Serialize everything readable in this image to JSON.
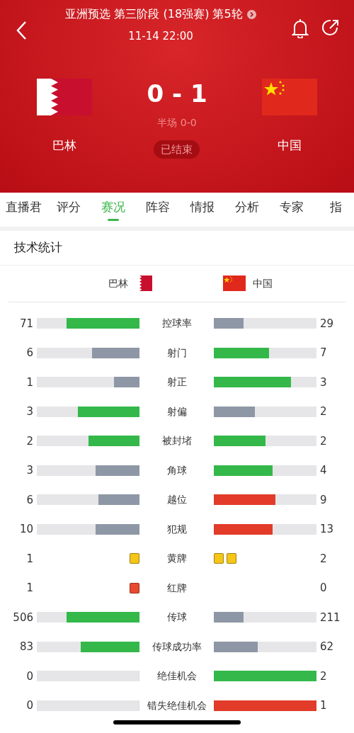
{
  "header": {
    "title": "亚洲预选 第三阶段 (18强赛) 第5轮",
    "time": "11-14 22:00",
    "home": {
      "name": "巴林",
      "kind": "bahrain"
    },
    "away": {
      "name": "中国",
      "kind": "china"
    },
    "score": "0 - 1",
    "half_time": "半场 0-0",
    "status": "已结束"
  },
  "tabs": [
    {
      "label": "直播君",
      "selected": false
    },
    {
      "label": "评分",
      "selected": false
    },
    {
      "label": "赛况",
      "selected": true
    },
    {
      "label": "阵容",
      "selected": false
    },
    {
      "label": "情报",
      "selected": false
    },
    {
      "label": "分析",
      "selected": false
    },
    {
      "label": "专家",
      "selected": false
    },
    {
      "label": "指",
      "selected": false
    }
  ],
  "stats": {
    "title": "技术统计",
    "home_team": "巴林",
    "away_team": "中国",
    "rows": [
      {
        "kind": "bar",
        "label": "控球率",
        "home": {
          "value": "71",
          "level": 0.71,
          "color": "#34b84a"
        },
        "away": {
          "value": "29",
          "level": 0.29,
          "color": "#8e97a5"
        }
      },
      {
        "kind": "bar",
        "label": "射门",
        "home": {
          "value": "6",
          "level": 0.46,
          "color": "#8e97a5"
        },
        "away": {
          "value": "7",
          "level": 0.54,
          "color": "#34b84a"
        }
      },
      {
        "kind": "bar",
        "label": "射正",
        "home": {
          "value": "1",
          "level": 0.25,
          "color": "#8e97a5"
        },
        "away": {
          "value": "3",
          "level": 0.75,
          "color": "#34b84a"
        }
      },
      {
        "kind": "bar",
        "label": "射偏",
        "home": {
          "value": "3",
          "level": 0.6,
          "color": "#34b84a"
        },
        "away": {
          "value": "2",
          "level": 0.4,
          "color": "#8e97a5"
        }
      },
      {
        "kind": "bar",
        "label": "被封堵",
        "home": {
          "value": "2",
          "level": 0.5,
          "color": "#34b84a"
        },
        "away": {
          "value": "2",
          "level": 0.5,
          "color": "#34b84a"
        }
      },
      {
        "kind": "bar",
        "label": "角球",
        "home": {
          "value": "3",
          "level": 0.43,
          "color": "#8e97a5"
        },
        "away": {
          "value": "4",
          "level": 0.57,
          "color": "#34b84a"
        }
      },
      {
        "kind": "bar",
        "label": "越位",
        "home": {
          "value": "6",
          "level": 0.4,
          "color": "#8e97a5"
        },
        "away": {
          "value": "9",
          "level": 0.6,
          "color": "#e23b2a"
        }
      },
      {
        "kind": "bar",
        "label": "犯规",
        "home": {
          "value": "10",
          "level": 0.43,
          "color": "#8e97a5"
        },
        "away": {
          "value": "13",
          "level": 0.57,
          "color": "#e23b2a"
        }
      },
      {
        "kind": "cards",
        "label": "黄牌",
        "home": {
          "value": "1",
          "color": "#f5c518"
        },
        "away": {
          "value": "2",
          "color": "#f5c518"
        }
      },
      {
        "kind": "cards",
        "label": "红牌",
        "home": {
          "value": "1",
          "color": "#e8492e"
        },
        "away": {
          "value": "0"
        }
      },
      {
        "kind": "bar",
        "label": "传球",
        "home": {
          "value": "506",
          "level": 0.71,
          "color": "#34b84a"
        },
        "away": {
          "value": "211",
          "level": 0.29,
          "color": "#8e97a5"
        }
      },
      {
        "kind": "bar",
        "label": "传球成功率",
        "home": {
          "value": "83",
          "level": 0.57,
          "color": "#34b84a"
        },
        "away": {
          "value": "62",
          "level": 0.43,
          "color": "#8e97a5"
        }
      },
      {
        "kind": "bar",
        "label": "绝佳机会",
        "home": {
          "value": "0",
          "level": 0
        },
        "away": {
          "value": "2",
          "level": 1,
          "color": "#34b84a"
        }
      },
      {
        "kind": "bar",
        "label": "错失绝佳机会",
        "home": {
          "value": "0",
          "level": 0
        },
        "away": {
          "value": "1",
          "level": 1,
          "color": "#e23b2a"
        }
      }
    ]
  }
}
